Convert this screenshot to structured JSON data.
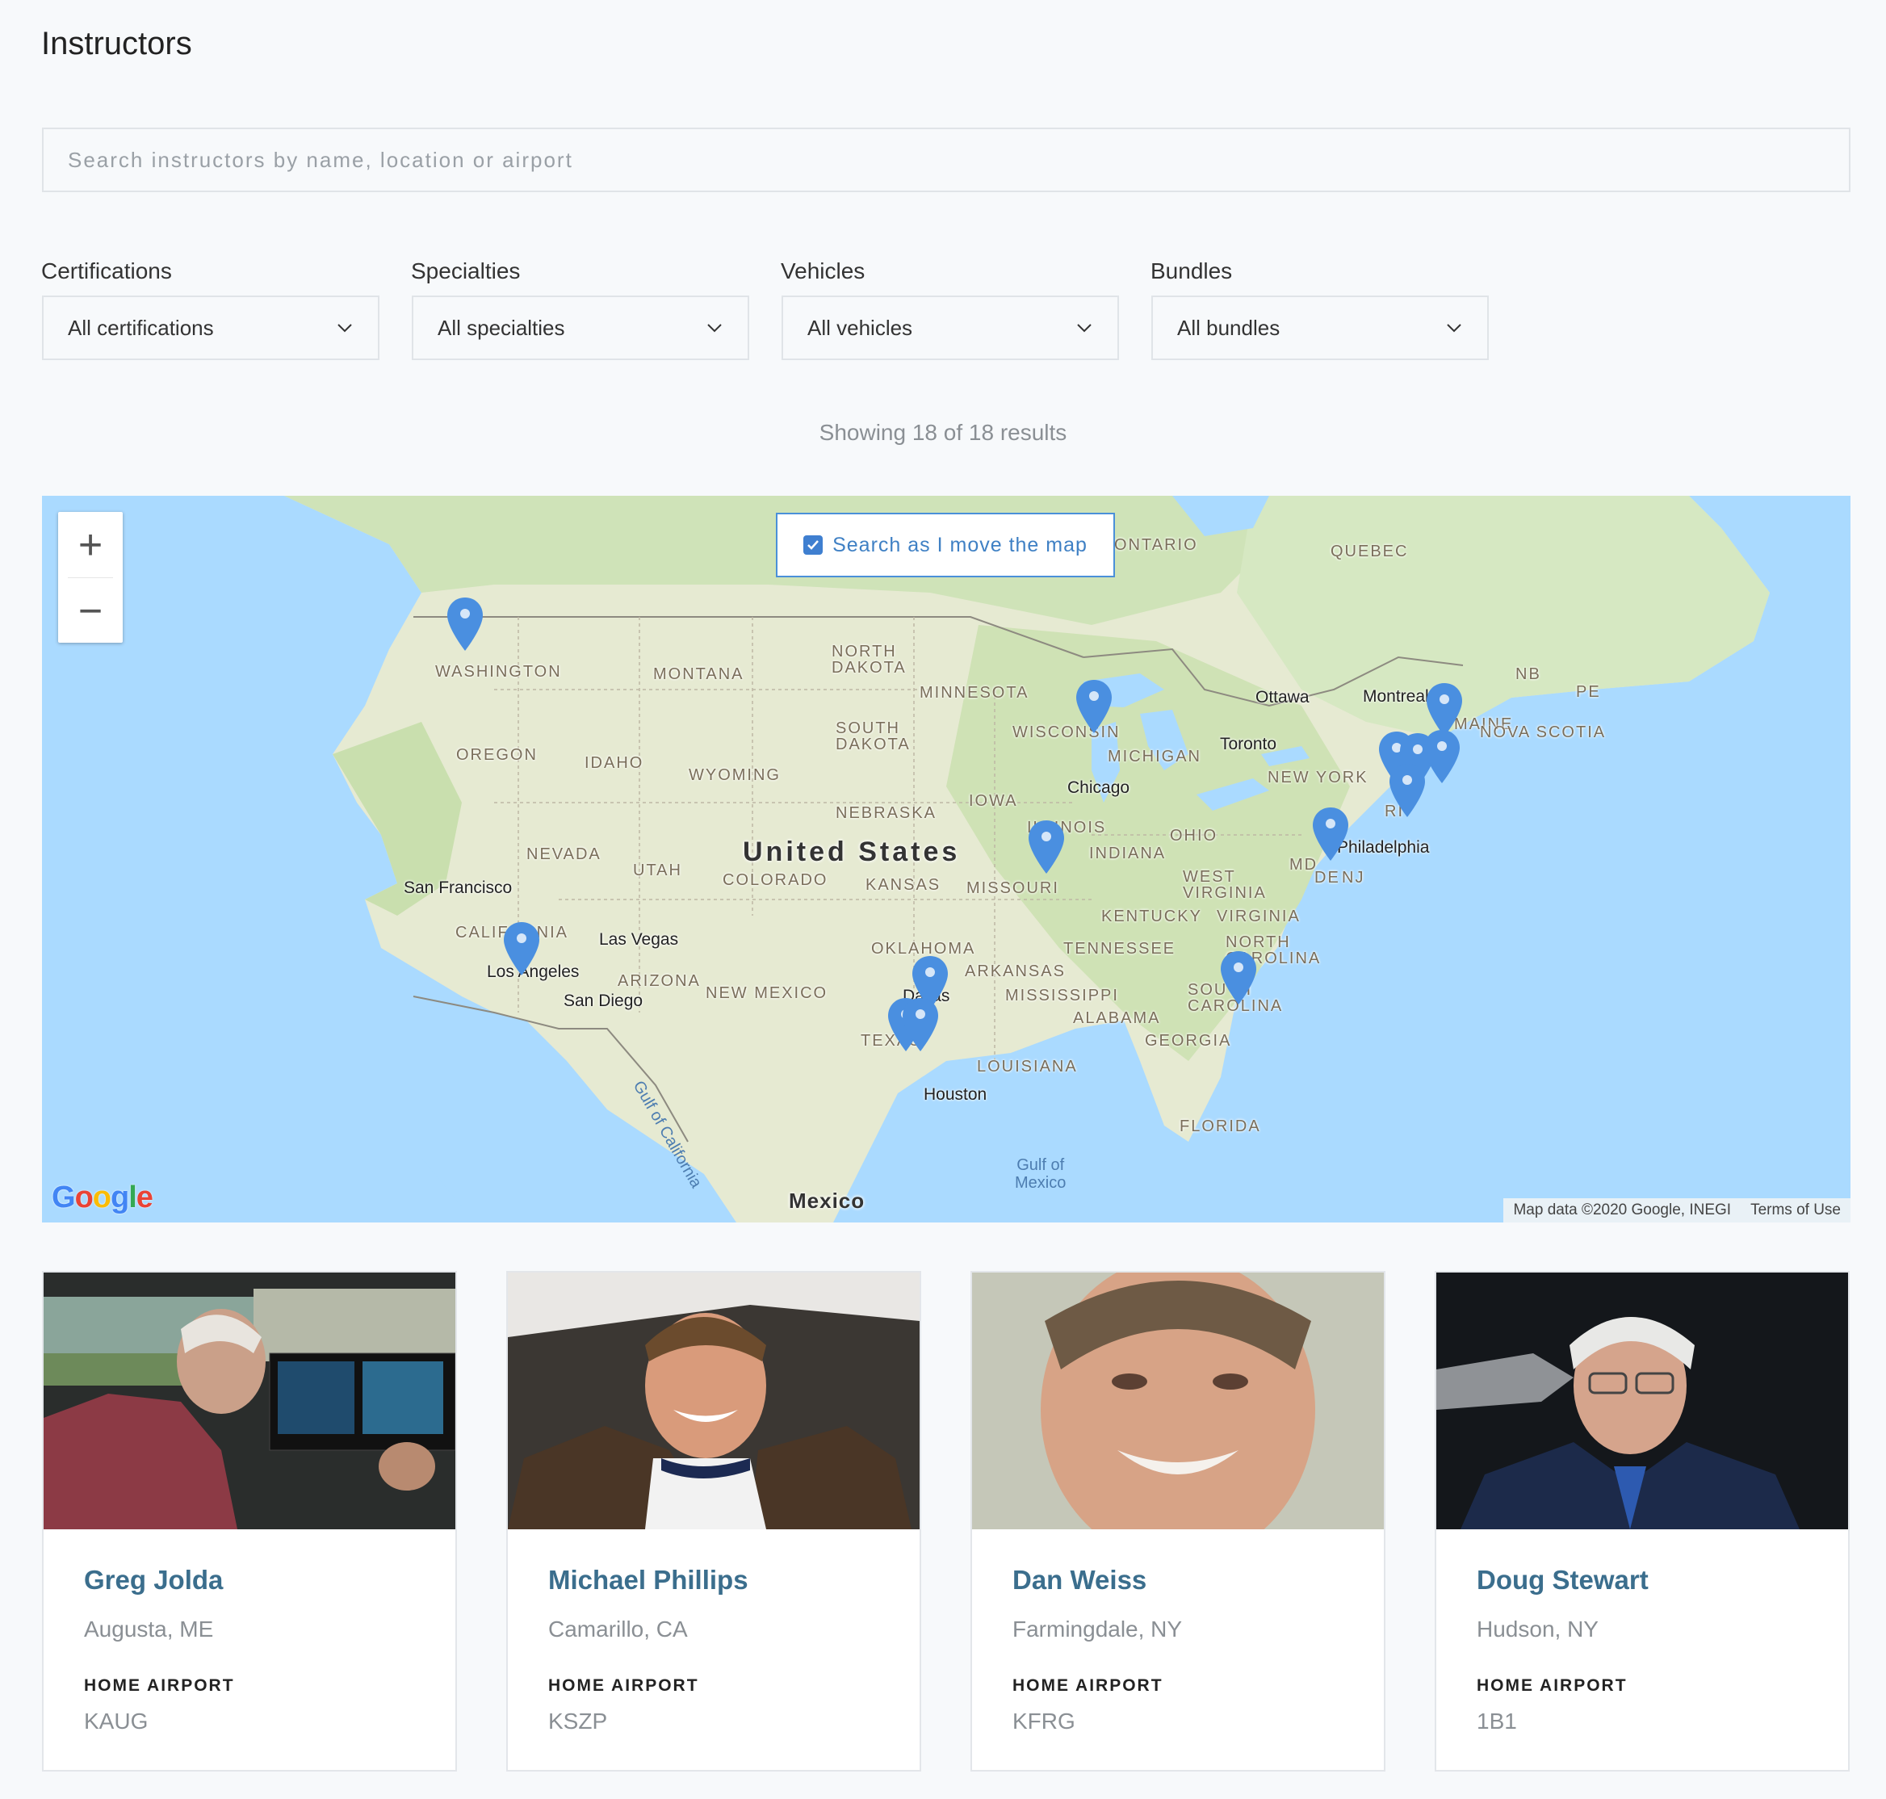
{
  "page": {
    "title": "Instructors"
  },
  "search": {
    "placeholder": "Search instructors by name, location or airport"
  },
  "filters": [
    {
      "label": "Certifications",
      "value": "All certifications"
    },
    {
      "label": "Specialties",
      "value": "All specialties"
    },
    {
      "label": "Vehicles",
      "value": "All vehicles"
    },
    {
      "label": "Bundles",
      "value": "All bundles"
    }
  ],
  "results": {
    "text": "Showing 18 of 18 results"
  },
  "map": {
    "search_as_move_label": "Search as I move the map",
    "search_as_move_checked": true,
    "zoom_in": "+",
    "zoom_out": "−",
    "google": "Google",
    "credits": "Map data ©2020 Google, INEGI",
    "terms": "Terms of Use",
    "country": "United States",
    "mexico": "Mexico",
    "water": {
      "gulf_mexico": "Gulf of\nMexico",
      "gulf_california": "Gulf of California"
    },
    "states": [
      "Washington",
      "Montana",
      "North Dakota",
      "Minnesota",
      "Oregon",
      "Idaho",
      "South Dakota",
      "Wyoming",
      "Wisconsin",
      "Michigan",
      "Nebraska",
      "Iowa",
      "Nevada",
      "Utah",
      "Colorado",
      "Kansas",
      "Missouri",
      "Illinois",
      "Indiana",
      "Ohio",
      "California",
      "Arizona",
      "New Mexico",
      "Oklahoma",
      "Arkansas",
      "Tennessee",
      "Kentucky",
      "Virginia",
      "West Virginia",
      "North Carolina",
      "South Carolina",
      "Mississippi",
      "Alabama",
      "Georgia",
      "Texas",
      "Louisiana",
      "Florida",
      "New York",
      "Maine",
      "Quebec",
      "Ontario",
      "NB",
      "PE",
      "Nova Scotia",
      "MD",
      "DE",
      "NJ",
      "RI"
    ],
    "cities": [
      "Ottawa",
      "Montreal",
      "Toronto",
      "Chicago",
      "Philadelphia",
      "San Francisco",
      "Las Vegas",
      "Los Angeles",
      "San Diego",
      "Dallas",
      "Houston"
    ],
    "colors": {
      "water": "#aadaff",
      "land": "#e8ecd7",
      "pin": "#4a8fe0",
      "accent": "#3f80c4"
    }
  },
  "instructors": [
    {
      "name": "Greg Jolda",
      "location": "Augusta, ME",
      "airport_label": "HOME AIRPORT",
      "airport": "KAUG"
    },
    {
      "name": "Michael Phillips",
      "location": "Camarillo, CA",
      "airport_label": "HOME AIRPORT",
      "airport": "KSZP"
    },
    {
      "name": "Dan Weiss",
      "location": "Farmingdale, NY",
      "airport_label": "HOME AIRPORT",
      "airport": "KFRG"
    },
    {
      "name": "Doug Stewart",
      "location": "Hudson, NY",
      "airport_label": "HOME AIRPORT",
      "airport": "1B1"
    }
  ]
}
